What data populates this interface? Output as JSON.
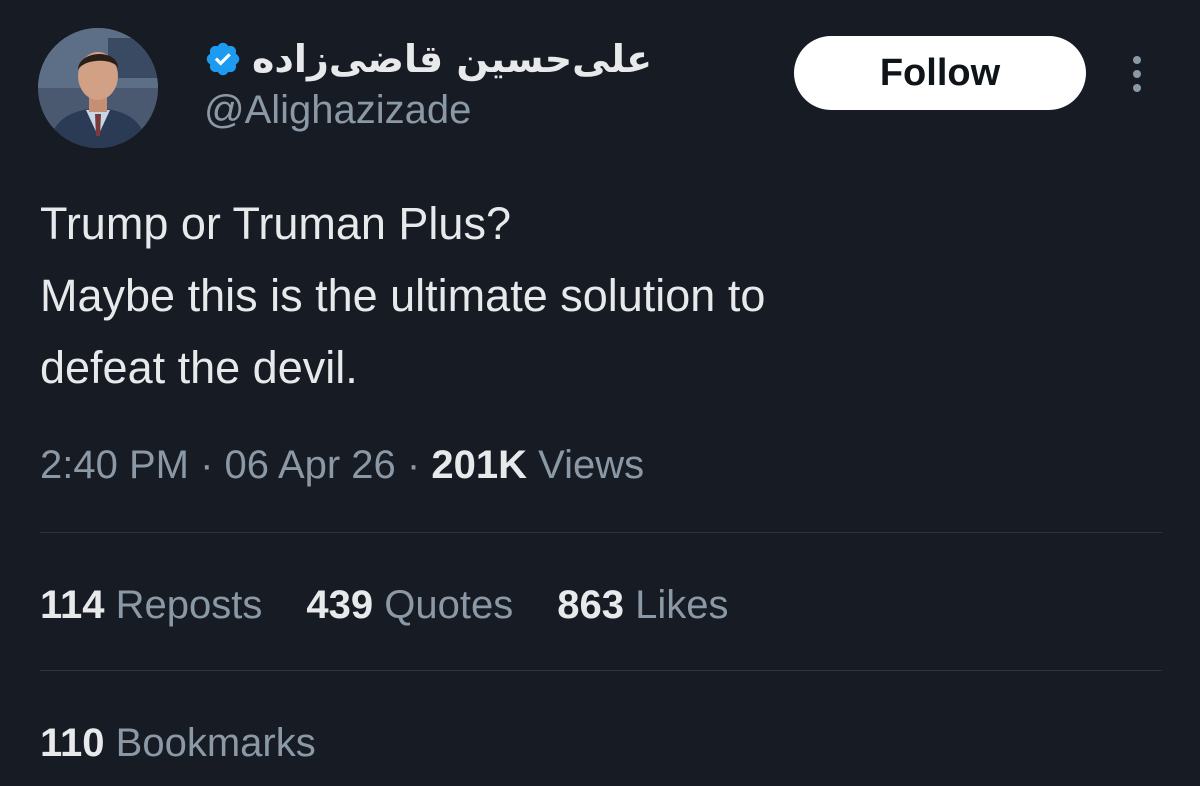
{
  "author": {
    "display_name": "علی‌حسین قاضی‌زاده",
    "handle": "@Alighazizade",
    "verified_icon": "verified-badge-icon",
    "avatar_icon": "avatar-photo"
  },
  "actions": {
    "follow_label": "Follow",
    "more_icon": "more-dots-icon"
  },
  "tweet": {
    "lines": [
      "Trump or Truman Plus?",
      "Maybe this is the ultimate solution to",
      "defeat the devil."
    ]
  },
  "meta": {
    "time": "2:40 PM",
    "separator": "·",
    "date": "06 Apr 26",
    "views_count": "201K",
    "views_label": "Views"
  },
  "stats": {
    "reposts_count": "114",
    "reposts_label": "Reposts",
    "quotes_count": "439",
    "quotes_label": "Quotes",
    "likes_count": "863",
    "likes_label": "Likes",
    "bookmarks_count": "110",
    "bookmarks_label": "Bookmarks"
  },
  "colors": {
    "background": "#161b24",
    "primary_text": "#e7e9ea",
    "secondary_text": "#8b98a5",
    "verified_blue": "#1d9bf0",
    "follow_bg": "#ffffff"
  }
}
